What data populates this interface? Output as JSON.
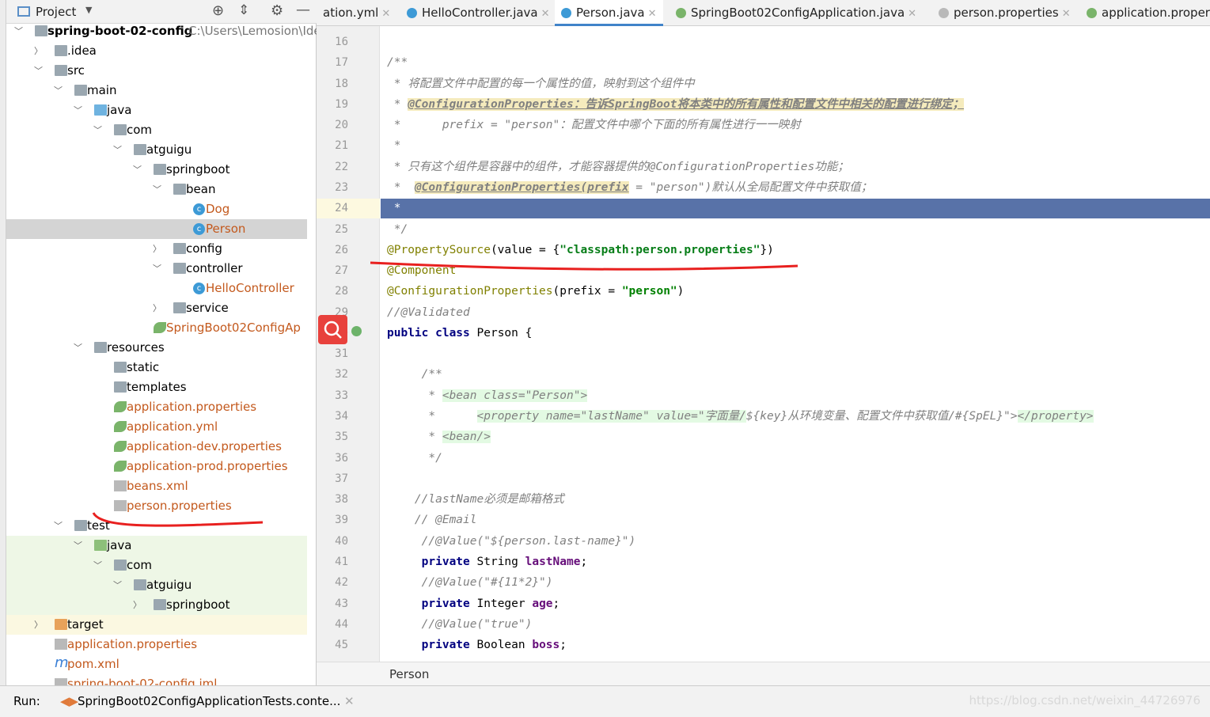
{
  "project_panel": {
    "title": "Project",
    "icons": [
      "target-icon",
      "collapse-icon",
      "gear-icon",
      "minimize-icon"
    ]
  },
  "tree": [
    {
      "level": 0,
      "arrow": "down",
      "icon": "module",
      "label": "spring-boot-02-config",
      "path": "C:\\Users\\Lemosion\\Ide",
      "bold": true
    },
    {
      "level": 1,
      "arrow": "right",
      "icon": "folder",
      "label": ".idea"
    },
    {
      "level": 1,
      "arrow": "down",
      "icon": "folder",
      "label": "src"
    },
    {
      "level": 2,
      "arrow": "down",
      "icon": "folder",
      "label": "main"
    },
    {
      "level": 3,
      "arrow": "down",
      "icon": "folder-blue",
      "label": "java"
    },
    {
      "level": 4,
      "arrow": "down",
      "icon": "package",
      "label": "com"
    },
    {
      "level": 5,
      "arrow": "down",
      "icon": "package",
      "label": "atguigu"
    },
    {
      "level": 6,
      "arrow": "down",
      "icon": "package",
      "label": "springboot"
    },
    {
      "level": 7,
      "arrow": "down",
      "icon": "package",
      "label": "bean"
    },
    {
      "level": 8,
      "icon": "class",
      "label": "Dog",
      "vcs": true
    },
    {
      "level": 8,
      "icon": "class",
      "label": "Person",
      "vcs": true,
      "selected": true
    },
    {
      "level": 7,
      "arrow": "right",
      "icon": "package",
      "label": "config"
    },
    {
      "level": 7,
      "arrow": "down",
      "icon": "package",
      "label": "controller"
    },
    {
      "level": 8,
      "icon": "class",
      "label": "HelloController",
      "vcs": true
    },
    {
      "level": 7,
      "arrow": "right",
      "icon": "package",
      "label": "service"
    },
    {
      "level": 6,
      "icon": "spring",
      "label": "SpringBoot02ConfigAp",
      "vcs": true
    },
    {
      "level": 3,
      "arrow": "down",
      "icon": "folder",
      "label": "resources"
    },
    {
      "level": 4,
      "icon": "folder",
      "label": "static"
    },
    {
      "level": 4,
      "icon": "folder",
      "label": "templates"
    },
    {
      "level": 4,
      "icon": "spring-config",
      "label": "application.properties",
      "vcs": true
    },
    {
      "level": 4,
      "icon": "spring-config",
      "label": "application.yml",
      "vcs": true
    },
    {
      "level": 4,
      "icon": "spring-config",
      "label": "application-dev.properties",
      "vcs": true
    },
    {
      "level": 4,
      "icon": "spring-config",
      "label": "application-prod.properties",
      "vcs": true
    },
    {
      "level": 4,
      "icon": "xml",
      "label": "beans.xml",
      "vcs": true
    },
    {
      "level": 4,
      "icon": "properties",
      "label": "person.properties",
      "vcs": true
    },
    {
      "level": 2,
      "arrow": "down",
      "icon": "folder",
      "label": "test"
    },
    {
      "level": 3,
      "arrow": "down",
      "icon": "folder-green",
      "label": "java",
      "bg": "test"
    },
    {
      "level": 4,
      "arrow": "down",
      "icon": "package",
      "label": "com",
      "bg": "test"
    },
    {
      "level": 5,
      "arrow": "down",
      "icon": "package",
      "label": "atguigu",
      "bg": "test"
    },
    {
      "level": 6,
      "arrow": "right",
      "icon": "package",
      "label": "springboot",
      "bg": "test"
    },
    {
      "level": 1,
      "arrow": "right",
      "icon": "folder-orange",
      "label": "target",
      "bg": "excl"
    },
    {
      "level": 1,
      "icon": "properties",
      "label": "application.properties",
      "vcs": true
    },
    {
      "level": 1,
      "icon": "maven",
      "label": "pom.xml",
      "vcs": true
    },
    {
      "level": 1,
      "icon": "iml",
      "label": "spring-boot-02-config.iml",
      "vcs": true
    }
  ],
  "tabs": [
    {
      "label": "ation.yml",
      "icon": "spring-config"
    },
    {
      "label": "HelloController.java",
      "icon": "class"
    },
    {
      "label": "Person.java",
      "icon": "class",
      "active": true
    },
    {
      "label": "SpringBoot02ConfigApplication.java",
      "icon": "spring"
    },
    {
      "label": "person.properties",
      "icon": "properties"
    },
    {
      "label": "application.proper",
      "icon": "spring-config"
    }
  ],
  "editor": {
    "first_line": 16,
    "current_line": 24,
    "lines": [
      [],
      [
        [
          "c",
          "/**"
        ]
      ],
      [
        [
          "c",
          " * 将配置文件中配置的每一个属性的值，映射到这个组件中"
        ]
      ],
      [
        [
          "c",
          " * "
        ],
        [
          "ct",
          "@ConfigurationProperties：告诉SpringBoot将本类中的所有属性和配置文件中相关的配置进行绑定；"
        ]
      ],
      [
        [
          "c",
          " *      prefix = \"person\"：配置文件中哪个下面的所有属性进行一一映射"
        ]
      ],
      [
        [
          "c",
          " *"
        ]
      ],
      [
        [
          "c",
          " * 只有这个组件是容器中的组件，才能容器提供的@ConfigurationProperties功能；"
        ]
      ],
      [
        [
          "c",
          " *  "
        ],
        [
          "ct",
          "@ConfigurationProperties(prefix"
        ],
        [
          "c",
          " = \"person\")默认从全局配置文件中获取值；"
        ]
      ],
      [
        [
          "w",
          " *"
        ]
      ],
      [
        [
          "c",
          " */"
        ]
      ],
      [
        [
          "an",
          "@PropertySource"
        ],
        [
          "",
          "(value = {"
        ],
        [
          "st",
          "\"classpath:person.properties\""
        ],
        [
          "",
          "})"
        ]
      ],
      [
        [
          "an",
          "@Component"
        ]
      ],
      [
        [
          "an",
          "@ConfigurationProperties"
        ],
        [
          "",
          "(prefix = "
        ],
        [
          "st2",
          "\"person\""
        ],
        [
          "",
          ")"
        ]
      ],
      [
        [
          "c",
          "//@Validated"
        ]
      ],
      [
        [
          "kw",
          "public class "
        ],
        [
          "",
          "Person {"
        ]
      ],
      [],
      [
        [
          "c",
          "     /**"
        ]
      ],
      [
        [
          "c",
          "      * "
        ],
        [
          "cx",
          "<bean class=\"Person\">"
        ]
      ],
      [
        [
          "c",
          "      *      "
        ],
        [
          "cx",
          "<property name=\"lastName\" value=\"字面量/"
        ],
        [
          "c",
          "${key}从环境变量、配置文件中获取值/#{SpEL}\">"
        ],
        [
          "cx",
          "</property>"
        ]
      ],
      [
        [
          "c",
          "      * "
        ],
        [
          "cx",
          "<bean/>"
        ]
      ],
      [
        [
          "c",
          "      */"
        ]
      ],
      [],
      [
        [
          "c",
          "    //lastName必须是邮箱格式"
        ]
      ],
      [
        [
          "c",
          "    // @Email"
        ]
      ],
      [
        [
          "c",
          "     //@Value(\"${person.last-name}\")"
        ]
      ],
      [
        [
          "kw",
          "     private "
        ],
        [
          "",
          "String "
        ],
        [
          "fd",
          "lastName"
        ],
        [
          "",
          ";"
        ]
      ],
      [
        [
          "c",
          "     //@Value(\"#{11*2}\")"
        ]
      ],
      [
        [
          "kw",
          "     private "
        ],
        [
          "",
          "Integer "
        ],
        [
          "fd",
          "age"
        ],
        [
          "",
          ";"
        ]
      ],
      [
        [
          "c",
          "     //@Value(\"true\")"
        ]
      ],
      [
        [
          "kw",
          "     private "
        ],
        [
          "",
          "Boolean "
        ],
        [
          "fd",
          "boss"
        ],
        [
          "",
          ";"
        ]
      ]
    ]
  },
  "breadcrumb": "Person",
  "run_bar": {
    "label": "Run:",
    "config": "SpringBoot02ConfigApplicationTests.conte..."
  },
  "watermark": "https://blog.csdn.net/weixin_44726976",
  "colors": {
    "selection": "#5872a8",
    "annotation_red": "#e8201f",
    "vcs_new": "#c3591d"
  }
}
